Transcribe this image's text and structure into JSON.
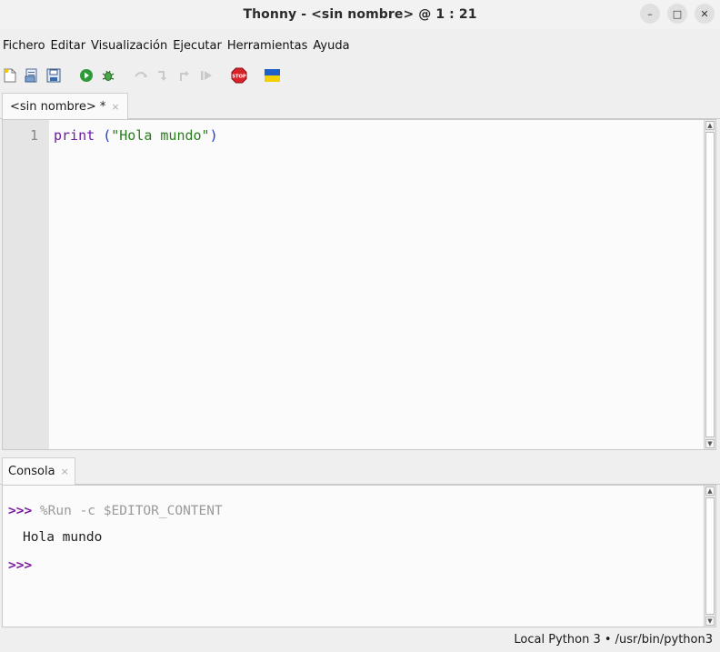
{
  "window": {
    "title": "Thonny  -  <sin nombre>  @  1 : 21",
    "controls": {
      "minimize": "–",
      "maximize": "□",
      "close": "✕"
    }
  },
  "menu": {
    "items": [
      "Fichero",
      "Editar",
      "Visualización",
      "Ejecutar",
      "Herramientas",
      "Ayuda"
    ]
  },
  "toolbar": {
    "icons": [
      "new-file-icon",
      "open-file-icon",
      "save-file-icon",
      "run-icon",
      "debug-icon",
      "step-over-icon",
      "step-into-icon",
      "step-out-icon",
      "resume-icon",
      "stop-icon",
      "ukraine-flag-icon"
    ],
    "stop_label": "STOP"
  },
  "editor": {
    "tab_label": "<sin nombre> *",
    "tab_close": "×",
    "line_number": "1",
    "code": {
      "keyword": "print",
      "space": " ",
      "open_paren": "(",
      "string": "\"Hola mundo\"",
      "close_paren": ")"
    }
  },
  "console": {
    "tab_label": "Consola",
    "tab_close": "×",
    "prompt": ">>>",
    "command": " %Run -c $EDITOR_CONTENT",
    "output": "Hola mundo",
    "prompt2": ">>>"
  },
  "status": {
    "text": "Local Python 3  •  /usr/bin/python3"
  },
  "colors": {
    "keyword": "#6f1aa8",
    "string": "#2a7a1e",
    "paren": "#1a39c9",
    "prompt": "#7a1da3"
  }
}
